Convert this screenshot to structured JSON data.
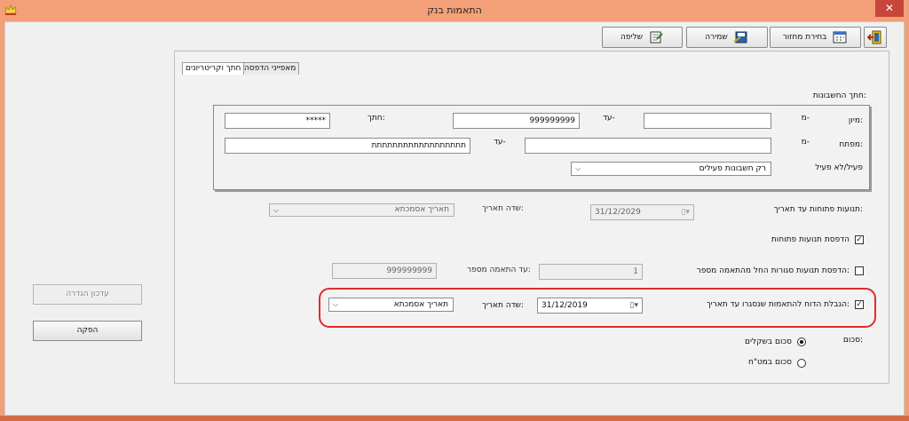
{
  "window": {
    "title": "התאמות בנק",
    "close_glyph": "✕"
  },
  "toolbar": {
    "exit_icon": "door-exit-icon",
    "choose_period_label": "בחירת מחזור",
    "save_label": "שמירה",
    "fetch_label": "שליפה"
  },
  "tabs": [
    {
      "label": "מאפייני הדפסה"
    },
    {
      "label": "חתך וקריטריונים"
    }
  ],
  "filters": {
    "section_title": "חתך החשבונות:",
    "sort_label": "מיון:",
    "from_label": "מ-",
    "to_label": "עד-",
    "sort_from_value": "",
    "sort_to_value": "999999999",
    "cut_label": "חתך:",
    "cut_value": "*****",
    "key_label": "מפתח:",
    "key_from_value": "",
    "key_to_value": "תתתתתתתתתתתתתתתתתת",
    "active_label": "פעיל/לא פעיל",
    "active_value": "רק חשבונות פעילים"
  },
  "open_moves": {
    "label": "תנועות פתוחות עד תאריך:",
    "date_value": "31/12/2029",
    "date_field_label": "שדה תאריך:",
    "date_field_value": "תאריך אסמכתא"
  },
  "print_open": {
    "label": "הדפסת תנועות פתוחות",
    "checked": true
  },
  "print_closed": {
    "label": "הדפסת תנועות סגורות החל מהתאמה מספר:",
    "checked": false,
    "from_value": "1",
    "to_label": "עד התאמה מספר:",
    "to_value": "999999999"
  },
  "limit_report": {
    "label": "הגבלת הדוח להתאמות שנסגרו עד תאריך:",
    "checked": true,
    "date_value": "31/12/2019",
    "date_field_label": "שדה תאריך:",
    "date_field_value": "תאריך אסמכתא"
  },
  "sum": {
    "label": "סכום:",
    "shekel_label": "סכום בשקלים",
    "shekel_selected": true,
    "foreign_label": "סכום במט\"ח",
    "foreign_selected": false
  },
  "side": {
    "update_definition_label": "עדכון הגדרה",
    "produce_label": "הפקה"
  },
  "colors": {
    "accent_frame": "#f3a078",
    "highlight_border": "#e02b2b"
  }
}
